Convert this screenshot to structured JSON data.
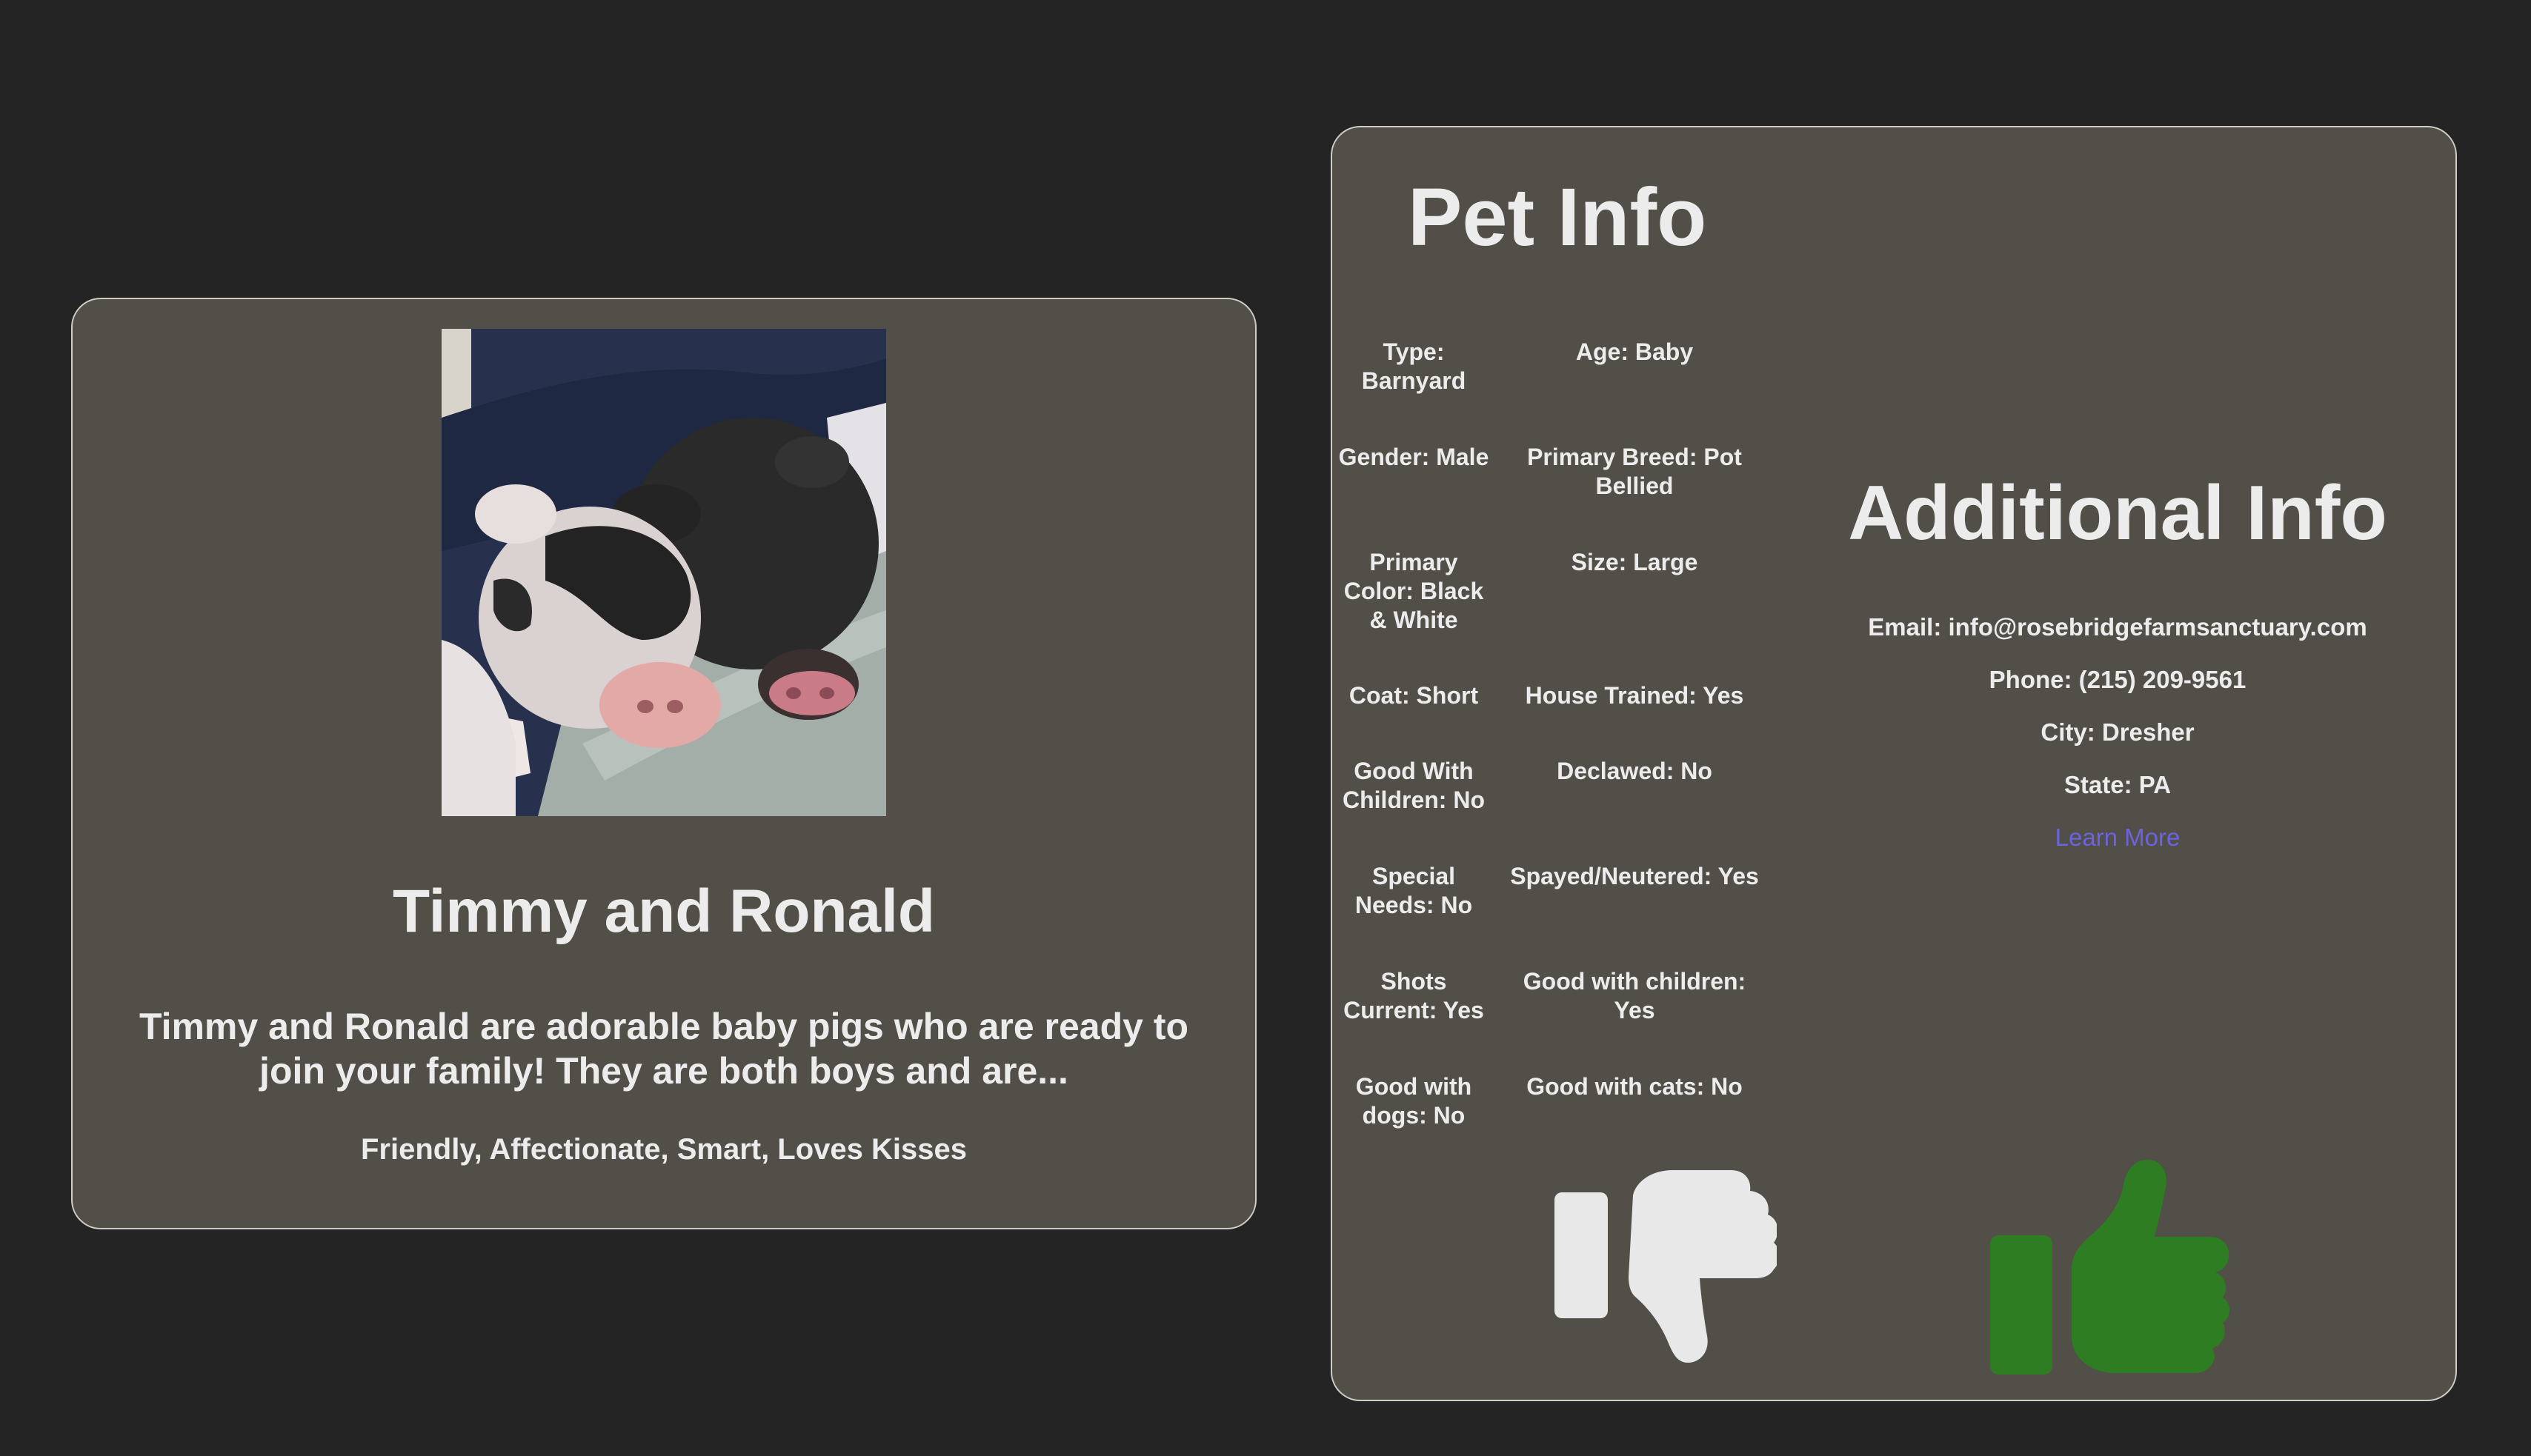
{
  "pet": {
    "photo_alt": "Two baby pigs",
    "name": "Timmy and Ronald",
    "description": "Timmy and Ronald are adorable baby pigs who are ready to join your family! They are both boys and are...",
    "traits": "Friendly, Affectionate, Smart, Loves Kisses"
  },
  "info": {
    "title": "Pet Info",
    "attributes": [
      "Type: Barnyard",
      "Age: Baby",
      "Gender: Male",
      "Primary Breed: Pot Bellied",
      "Primary Color: Black & White",
      "Size: Large",
      "Coat: Short",
      "House Trained: Yes",
      "Good With Children: No",
      "Declawed: No",
      "Special Needs: No",
      "Spayed/Neutered: Yes",
      "Shots Current: Yes",
      "Good with children: Yes",
      "Good with dogs: No",
      "Good with cats: No"
    ]
  },
  "additional": {
    "title": "Additional Info",
    "email": "Email: info@rosebridgefarmsanctuary.com",
    "phone": "Phone: (215) 209-9561",
    "city": "City: Dresher",
    "state": "State: PA",
    "learn_more": "Learn More"
  },
  "actions": {
    "dislike_icon": "thumbs-down-icon",
    "like_icon": "thumbs-up-icon",
    "dislike_color": "#e8e8e8",
    "like_color": "#2f7d22"
  },
  "colors": {
    "background": "#242424",
    "card": "#524f48",
    "link": "#6b63e0"
  }
}
